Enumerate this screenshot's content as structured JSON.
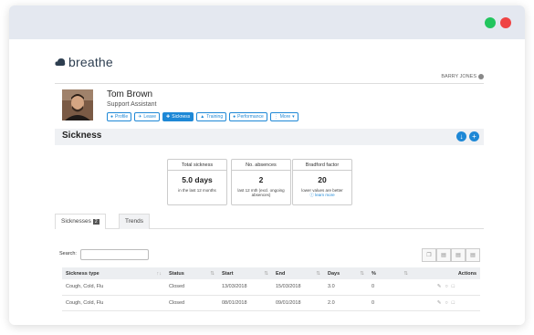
{
  "logo": {
    "text": "breathe"
  },
  "user_menu": {
    "label": "BARRY JONES"
  },
  "employee": {
    "name": "Tom Brown",
    "role": "Support Assistant"
  },
  "profile_tabs": [
    {
      "label": "Profile",
      "icon": "user-icon"
    },
    {
      "label": "Leave",
      "icon": "plane-icon"
    },
    {
      "label": "Sickness",
      "icon": "medkit-icon",
      "active": true
    },
    {
      "label": "Training",
      "icon": "grad-cap-icon"
    },
    {
      "label": "Performance",
      "icon": "users-icon"
    },
    {
      "label": "More",
      "icon": "more-icon"
    }
  ],
  "section": {
    "title": "Sickness"
  },
  "stats": [
    {
      "label": "Total sickness",
      "value": "5.0 days",
      "sub": "in the last 12 months"
    },
    {
      "label": "No. absences",
      "value": "2",
      "sub": "last 12 mth (excl. ongoing absences)"
    },
    {
      "label": "Bradford factor",
      "value": "20",
      "sub": "lower values are better",
      "link": "learn more"
    }
  ],
  "subtabs": [
    {
      "label": "Sicknesses",
      "badge": "2",
      "active": true
    },
    {
      "label": "Trends"
    }
  ],
  "search": {
    "label": "Search:",
    "value": ""
  },
  "table": {
    "columns": [
      "Sickness type",
      "Status",
      "Start",
      "End",
      "Days",
      "%",
      "Actions"
    ],
    "rows": [
      [
        "Cough, Cold, Flu",
        "Closed",
        "13/03/2018",
        "15/03/2018",
        "3.0",
        "0"
      ],
      [
        "Cough, Cold, Flu",
        "Closed",
        "08/01/2018",
        "09/01/2018",
        "2.0",
        "0"
      ]
    ]
  },
  "colors": {
    "accent": "#1e88d6",
    "titlebar": "#e4e8f0",
    "window_green": "#22c55e",
    "window_red": "#ef4444"
  }
}
